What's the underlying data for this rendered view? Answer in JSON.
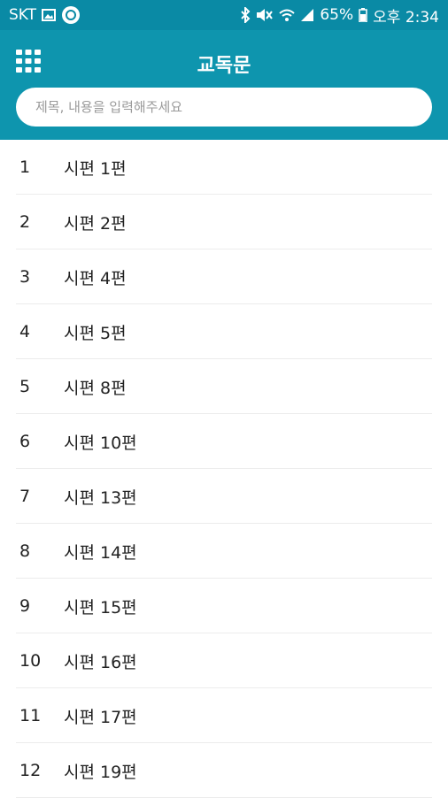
{
  "status_bar": {
    "carrier": "SKT",
    "battery": "65%",
    "time": "오후 2:34"
  },
  "header": {
    "title": "교독문",
    "menu_icon": "grid-icon"
  },
  "search": {
    "placeholder": "제목, 내용을 입력해주세요"
  },
  "items": [
    {
      "num": "1",
      "title": "시편 1편"
    },
    {
      "num": "2",
      "title": "시편 2편"
    },
    {
      "num": "3",
      "title": "시편 4편"
    },
    {
      "num": "4",
      "title": "시편 5편"
    },
    {
      "num": "5",
      "title": "시편 8편"
    },
    {
      "num": "6",
      "title": "시편 10편"
    },
    {
      "num": "7",
      "title": "시편 13편"
    },
    {
      "num": "8",
      "title": "시편 14편"
    },
    {
      "num": "9",
      "title": "시편 15편"
    },
    {
      "num": "10",
      "title": "시편 16편"
    },
    {
      "num": "11",
      "title": "시편 17편"
    },
    {
      "num": "12",
      "title": "시편 19편"
    }
  ]
}
